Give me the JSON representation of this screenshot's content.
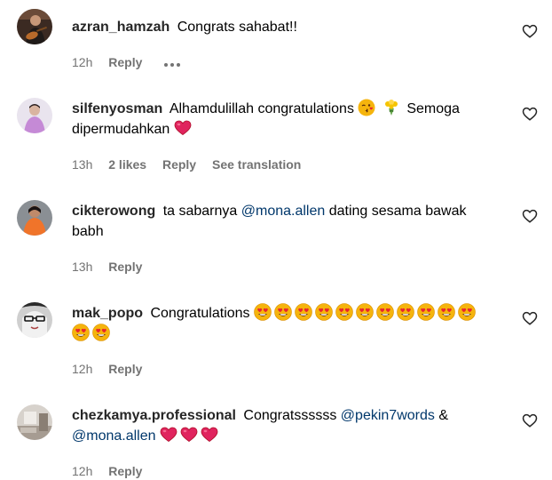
{
  "comments": [
    {
      "username": "azran_hamzah",
      "text_parts": [
        "Congrats sahabat!!"
      ],
      "time": "12h",
      "likes": "",
      "reply_label": "Reply",
      "translation_label": "",
      "avatar_icon": "person-guitar-avatar"
    },
    {
      "username": "silfenyosman",
      "text_parts": [
        "Alhamdulillah congratulations",
        "Semoga",
        "dipermudahkan"
      ],
      "time": "13h",
      "likes": "2 likes",
      "reply_label": "Reply",
      "translation_label": "See translation",
      "avatar_icon": "person-pink-avatar",
      "emojis": [
        "kissing-face-emoji",
        "bouquet-emoji",
        "red-heart-emoji"
      ]
    },
    {
      "username": "cikterowong",
      "text_parts": [
        "ta sabarnya",
        "@mona.allen",
        "dating sesama bawak",
        "babh"
      ],
      "time": "13h",
      "likes": "",
      "reply_label": "Reply",
      "translation_label": "",
      "avatar_icon": "person-orange-avatar"
    },
    {
      "username": "mak_popo",
      "text_parts": [
        "Congratulations"
      ],
      "time": "12h",
      "likes": "",
      "reply_label": "Reply",
      "translation_label": "",
      "avatar_icon": "person-glasses-avatar",
      "emoji_count": 13,
      "emoji_name": "heart-eyes-emoji"
    },
    {
      "username": "chezkamya.professional",
      "text_parts": [
        "Congratssssss",
        "@pekin7words",
        "&",
        "@mona.allen"
      ],
      "time": "12h",
      "likes": "",
      "reply_label": "Reply",
      "translation_label": "",
      "avatar_icon": "room-avatar",
      "emoji_count": 3,
      "emoji_name": "red-heart-emoji"
    }
  ],
  "colors": {
    "username": "#262626",
    "meta": "#737373",
    "mention": "#00376b",
    "heart_red": "#e0245e"
  }
}
